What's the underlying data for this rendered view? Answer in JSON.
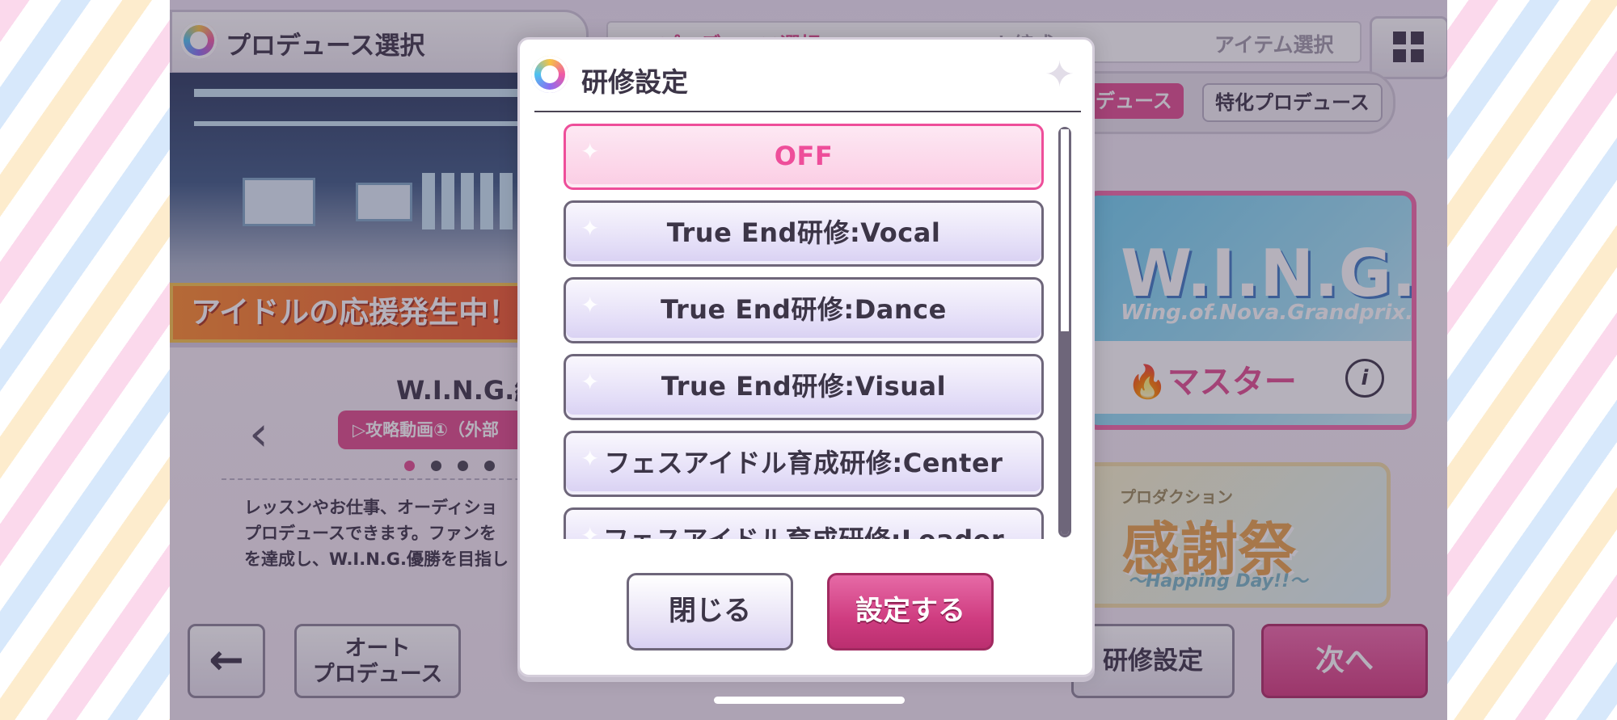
{
  "header": {
    "title": "プロデュース選択",
    "steps": [
      "プロデュース選択",
      "ユニット編成",
      "アイテム選択"
    ]
  },
  "mode_tabs": [
    "プロデュース",
    "特化プロデュース"
  ],
  "banner": {
    "cheer_text": "アイドルの応援発生中！"
  },
  "card": {
    "title": "W.I.N.G.編",
    "video_label": "▷攻略動画①（外部",
    "description": "レッスンやお仕事、オーディショ\nプロデュースできます。ファンを\nを達成し、W.I.N.G.優勝を目指し"
  },
  "wing_card": {
    "logo": "W.I.N.G.",
    "subtitle": "Wing.of.Nova.Grandprix.",
    "difficulty": "マスター",
    "info_glyph": "i"
  },
  "fest_card": {
    "small": "プロダクション",
    "big": "感謝祭",
    "sub": "～Happing Day!!～"
  },
  "bottom": {
    "back_glyph": "←",
    "auto_produce": "オート\nプロデュース",
    "training": "研修設定",
    "next": "次へ"
  },
  "dialog": {
    "title": "研修設定",
    "options": [
      {
        "label": "OFF",
        "selected": true
      },
      {
        "label": "True End研修:Vocal",
        "selected": false
      },
      {
        "label": "True End研修:Dance",
        "selected": false
      },
      {
        "label": "True End研修:Visual",
        "selected": false
      },
      {
        "label": "フェスアイドル育成研修:Center",
        "selected": false
      },
      {
        "label": "フェスアイドル育成研修:Leader",
        "selected": false
      }
    ],
    "close_label": "閉じる",
    "confirm_label": "設定する"
  },
  "colors": {
    "accent_pink": "#ee4e9a",
    "button_pink": "#cf3c80",
    "text_dark": "#3c3547"
  }
}
